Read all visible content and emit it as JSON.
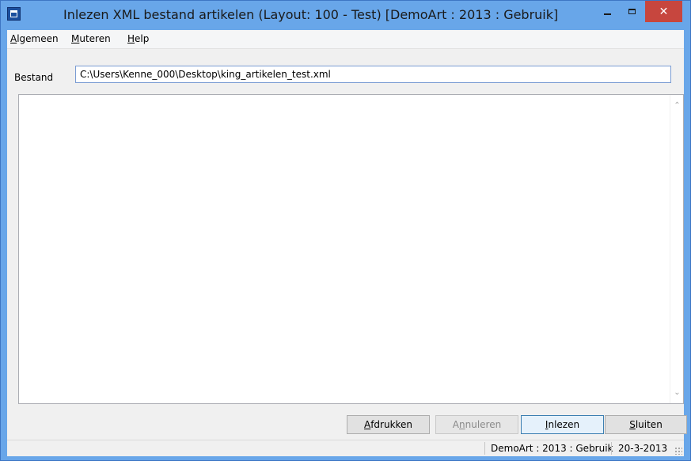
{
  "window": {
    "title": "Inlezen XML bestand artikelen (Layout: 100 - Test)  [DemoArt : 2013 : Gebruik]",
    "icon": "app-window-icon",
    "controls": {
      "minimize": "–",
      "maximize": "□",
      "close": "✕"
    }
  },
  "menu": {
    "items": [
      {
        "first": "A",
        "rest": "lgemeen"
      },
      {
        "first": "M",
        "rest": "uteren"
      },
      {
        "first": "H",
        "rest": "elp"
      }
    ]
  },
  "form": {
    "bestand_label": "Bestand",
    "bestand_value": "C:\\Users\\Kenne_000\\Desktop\\king_artikelen_test.xml"
  },
  "output": {
    "text": "",
    "scroll_up": "⌃",
    "scroll_down": "⌄"
  },
  "buttons": {
    "afdrukken": {
      "first": "A",
      "rest": "fdrukken"
    },
    "annuleren": {
      "pre": "A",
      "mnemonic": "n",
      "rest": "nuleren"
    },
    "inlezen": {
      "first": "I",
      "rest": "nlezen"
    },
    "sluiten": {
      "first": "S",
      "rest": "luiten"
    }
  },
  "status": {
    "context": "DemoArt : 2013 : Gebruik",
    "date": "20-3-2013"
  },
  "colors": {
    "titlebar": "#68a6e9",
    "close_button": "#c7463e"
  }
}
